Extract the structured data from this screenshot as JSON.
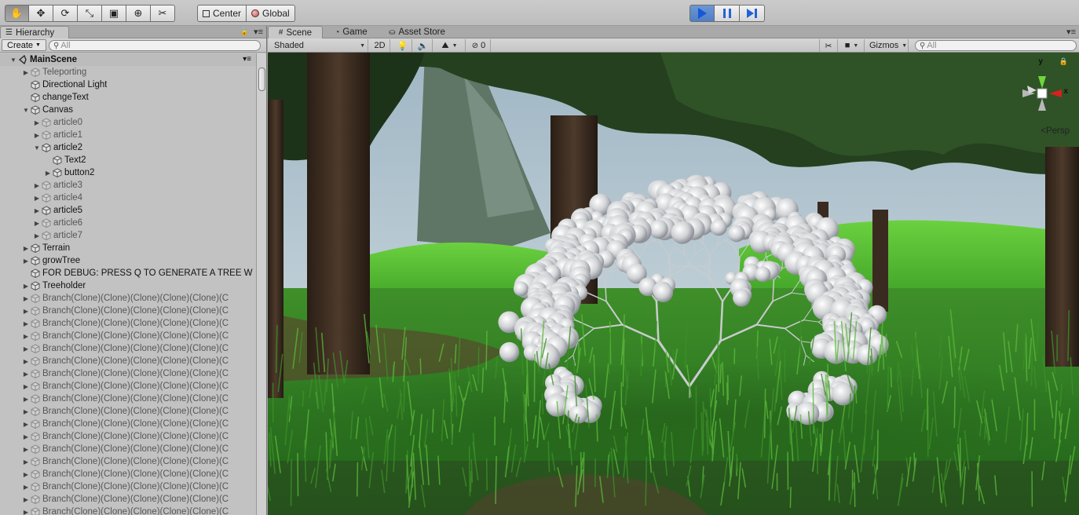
{
  "toolbar": {
    "transform_tools": [
      {
        "icon": "hand-icon",
        "glyph": "✋",
        "active": true
      },
      {
        "icon": "move-icon",
        "glyph": "✥",
        "active": false
      },
      {
        "icon": "rotate-icon",
        "glyph": "⟳",
        "active": false
      },
      {
        "icon": "scale-icon",
        "glyph": "⤡",
        "active": false
      },
      {
        "icon": "rect-tool-icon",
        "glyph": "▣",
        "active": false
      },
      {
        "icon": "transform-tool-icon",
        "glyph": "⊕",
        "active": false
      },
      {
        "icon": "custom-tool-icon",
        "glyph": "✂",
        "active": false
      }
    ],
    "pivot_mode": "Center",
    "pivot_space": "Global",
    "play_active": true
  },
  "hierarchy": {
    "tab_label": "Hierarchy",
    "create_label": "Create",
    "search_placeholder": "All",
    "scene_name": "MainScene",
    "items": [
      {
        "label": "Teleporting",
        "depth": 1,
        "arrow": "right",
        "inactive": true
      },
      {
        "label": "Directional Light",
        "depth": 1,
        "arrow": "",
        "inactive": false
      },
      {
        "label": "changeText",
        "depth": 1,
        "arrow": "",
        "inactive": false
      },
      {
        "label": "Canvas",
        "depth": 1,
        "arrow": "down",
        "inactive": false
      },
      {
        "label": "article0",
        "depth": 2,
        "arrow": "right",
        "inactive": true
      },
      {
        "label": "article1",
        "depth": 2,
        "arrow": "right",
        "inactive": true
      },
      {
        "label": "article2",
        "depth": 2,
        "arrow": "down",
        "inactive": false
      },
      {
        "label": "Text2",
        "depth": 3,
        "arrow": "",
        "inactive": false
      },
      {
        "label": "button2",
        "depth": 3,
        "arrow": "right",
        "inactive": false
      },
      {
        "label": "article3",
        "depth": 2,
        "arrow": "right",
        "inactive": true
      },
      {
        "label": "article4",
        "depth": 2,
        "arrow": "right",
        "inactive": true
      },
      {
        "label": "article5",
        "depth": 2,
        "arrow": "right",
        "inactive": false
      },
      {
        "label": "article6",
        "depth": 2,
        "arrow": "right",
        "inactive": true
      },
      {
        "label": "article7",
        "depth": 2,
        "arrow": "right",
        "inactive": true
      },
      {
        "label": "Terrain",
        "depth": 1,
        "arrow": "right",
        "inactive": false
      },
      {
        "label": "growTree",
        "depth": 1,
        "arrow": "right",
        "inactive": false
      },
      {
        "label": "FOR DEBUG: PRESS Q TO GENERATE A TREE W",
        "depth": 1,
        "arrow": "",
        "inactive": false
      },
      {
        "label": "Treeholder",
        "depth": 1,
        "arrow": "right",
        "inactive": false
      },
      {
        "label": "Branch(Clone)(Clone)(Clone)(Clone)(Clone)(C",
        "depth": 1,
        "arrow": "right",
        "inactive": true
      },
      {
        "label": "Branch(Clone)(Clone)(Clone)(Clone)(Clone)(C",
        "depth": 1,
        "arrow": "right",
        "inactive": true
      },
      {
        "label": "Branch(Clone)(Clone)(Clone)(Clone)(Clone)(C",
        "depth": 1,
        "arrow": "right",
        "inactive": true
      },
      {
        "label": "Branch(Clone)(Clone)(Clone)(Clone)(Clone)(C",
        "depth": 1,
        "arrow": "right",
        "inactive": true
      },
      {
        "label": "Branch(Clone)(Clone)(Clone)(Clone)(Clone)(C",
        "depth": 1,
        "arrow": "right",
        "inactive": true
      },
      {
        "label": "Branch(Clone)(Clone)(Clone)(Clone)(Clone)(C",
        "depth": 1,
        "arrow": "right",
        "inactive": true
      },
      {
        "label": "Branch(Clone)(Clone)(Clone)(Clone)(Clone)(C",
        "depth": 1,
        "arrow": "right",
        "inactive": true
      },
      {
        "label": "Branch(Clone)(Clone)(Clone)(Clone)(Clone)(C",
        "depth": 1,
        "arrow": "right",
        "inactive": true
      },
      {
        "label": "Branch(Clone)(Clone)(Clone)(Clone)(Clone)(C",
        "depth": 1,
        "arrow": "right",
        "inactive": true
      },
      {
        "label": "Branch(Clone)(Clone)(Clone)(Clone)(Clone)(C",
        "depth": 1,
        "arrow": "right",
        "inactive": true
      },
      {
        "label": "Branch(Clone)(Clone)(Clone)(Clone)(Clone)(C",
        "depth": 1,
        "arrow": "right",
        "inactive": true
      },
      {
        "label": "Branch(Clone)(Clone)(Clone)(Clone)(Clone)(C",
        "depth": 1,
        "arrow": "right",
        "inactive": true
      },
      {
        "label": "Branch(Clone)(Clone)(Clone)(Clone)(Clone)(C",
        "depth": 1,
        "arrow": "right",
        "inactive": true
      },
      {
        "label": "Branch(Clone)(Clone)(Clone)(Clone)(Clone)(C",
        "depth": 1,
        "arrow": "right",
        "inactive": true
      },
      {
        "label": "Branch(Clone)(Clone)(Clone)(Clone)(Clone)(C",
        "depth": 1,
        "arrow": "right",
        "inactive": true
      },
      {
        "label": "Branch(Clone)(Clone)(Clone)(Clone)(Clone)(C",
        "depth": 1,
        "arrow": "right",
        "inactive": true
      },
      {
        "label": "Branch(Clone)(Clone)(Clone)(Clone)(Clone)(C",
        "depth": 1,
        "arrow": "right",
        "inactive": true
      },
      {
        "label": "Branch(Clone)(Clone)(Clone)(Clone)(Clone)(C",
        "depth": 1,
        "arrow": "right",
        "inactive": true
      }
    ]
  },
  "scene_view": {
    "tabs": [
      {
        "label": "Scene",
        "icon": "grid-icon",
        "glyph": "#",
        "active": true
      },
      {
        "label": "Game",
        "icon": "pacman-icon",
        "glyph": "◔",
        "active": false
      },
      {
        "label": "Asset Store",
        "icon": "bag-icon",
        "glyph": "⛀",
        "active": false
      }
    ],
    "shading_mode": "Shaded",
    "mode_2d": "2D",
    "hidden_count": "0",
    "gizmos_label": "Gizmos",
    "search_placeholder": "All",
    "axis_y": "y",
    "axis_x": "x",
    "projection": "Persp"
  }
}
